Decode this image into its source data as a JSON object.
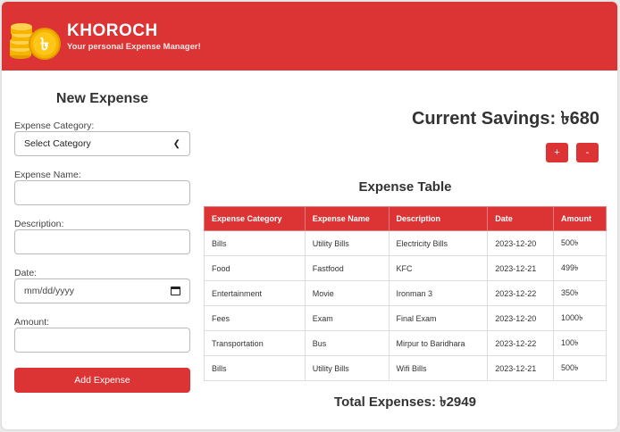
{
  "brand": {
    "title": "KHOROCH",
    "tagline": "Your personal Expense Manager!",
    "logo_symbol": "৳"
  },
  "form": {
    "title": "New Expense",
    "category_label": "Expense Category:",
    "category_value": "Select Category",
    "name_label": "Expense Name:",
    "name_value": "",
    "description_label": "Description:",
    "description_value": "",
    "date_label": "Date:",
    "date_placeholder": "mm/dd/yyyy",
    "amount_label": "Amount:",
    "amount_value": "",
    "submit_label": "Add Expense"
  },
  "savings": {
    "text": "Current Savings: ৳680"
  },
  "controls": {
    "plus_label": "+",
    "minus_label": "-"
  },
  "table": {
    "title": "Expense Table",
    "headers": [
      "Expense Category",
      "Expense Name",
      "Description",
      "Date",
      "Amount"
    ],
    "rows": [
      [
        "Bills",
        "Utility Bills",
        "Electricity Bills",
        "2023-12-20",
        "500৳"
      ],
      [
        "Food",
        "Fastfood",
        "KFC",
        "2023-12-21",
        "499৳"
      ],
      [
        "Entertainment",
        "Movie",
        "Ironman 3",
        "2023-12-22",
        "350৳"
      ],
      [
        "Fees",
        "Exam",
        "Final Exam",
        "2023-12-20",
        "1000৳"
      ],
      [
        "Transportation",
        "Bus",
        "Mirpur to Baridhara",
        "2023-12-22",
        "100৳"
      ],
      [
        "Bills",
        "Utility Bills",
        "Wifi Bills",
        "2023-12-21",
        "500৳"
      ]
    ]
  },
  "total": {
    "text": "Total Expenses: ৳2949"
  },
  "colors": {
    "accent": "#dc3434",
    "coin": "#f4b400"
  },
  "icons": {
    "logo": "coin-stack-icon",
    "select": "chevron-down-icon",
    "date": "calendar-icon"
  }
}
